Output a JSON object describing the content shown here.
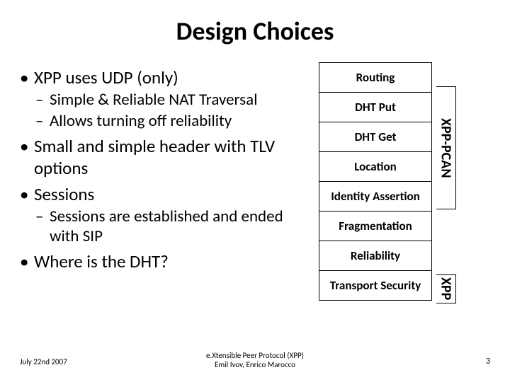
{
  "title": "Design Choices",
  "bullets": {
    "b1": "XPP uses UDP (only)",
    "b1a": "Simple & Reliable NAT Traversal",
    "b1b": "Allows turning off reliability",
    "b2": "Small and simple header with TLV options",
    "b3": "Sessions",
    "b3a": "Sessions are established and ended with SIP",
    "b4": "Where is the DHT?"
  },
  "stack": {
    "c1": "Routing",
    "c2": "DHT Put",
    "c3": "DHT Get",
    "c4": "Location",
    "c5": "Identity Assertion",
    "c6": "Fragmentation",
    "c7": "Reliability",
    "c8": "Transport Security"
  },
  "sidelabels": {
    "top": "XPP-PCAN",
    "bottom": "XPP"
  },
  "footer": {
    "date": "July 22nd 2007",
    "mid_line1": "e.Xtensible Peer Protocol (XPP)",
    "mid_line2": "Emil Ivov, Enrico Marocco",
    "page": "3"
  }
}
